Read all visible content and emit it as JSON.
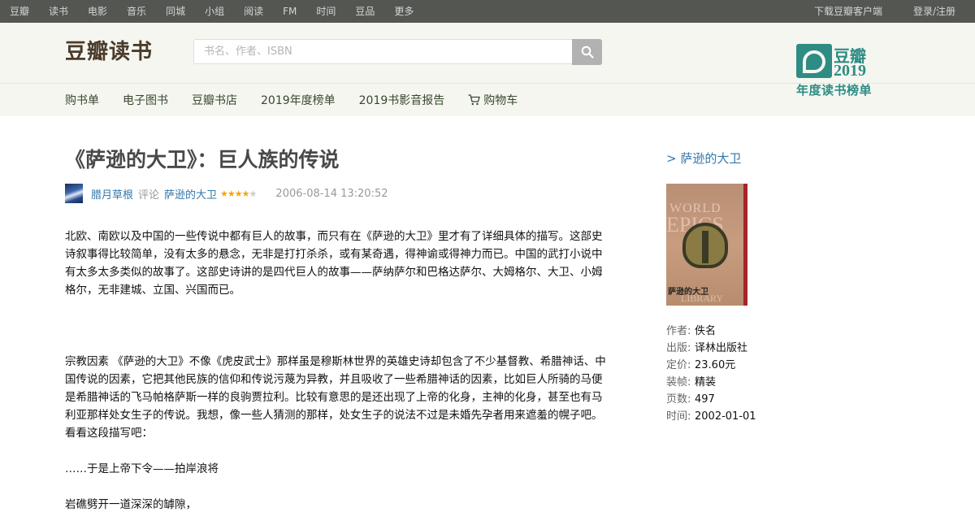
{
  "global_nav": {
    "left": [
      "豆瓣",
      "读书",
      "电影",
      "音乐",
      "同城",
      "小组",
      "阅读",
      "FM",
      "时间",
      "豆品",
      "更多"
    ],
    "right": [
      "下载豆瓣客户端",
      "登录/注册"
    ]
  },
  "header": {
    "logo": "豆瓣读书",
    "search_placeholder": "书名、作者、ISBN",
    "badge": {
      "name": "豆瓣",
      "year": "2019",
      "subtitle": "年度读书榜单"
    }
  },
  "subnav": [
    "购书单",
    "电子图书",
    "豆瓣书店",
    "2019年度榜单",
    "2019书影音报告",
    "购物车"
  ],
  "review": {
    "title": "《萨逊的大卫》：巨人族的传说",
    "author": "腊月草根",
    "verb": "评论",
    "book": "萨逊的大卫",
    "rating": 4,
    "date": "2006-08-14 13:20:52",
    "paragraphs": [
      "北欧、南欧以及中国的一些传说中都有巨人的故事，而只有在《萨逊的大卫》里才有了详细具体的描写。这部史诗叙事得比较简单，没有太多的悬念，无非是打打杀杀，或有某奇遇，得神谕或得神力而已。中国的武打小说中有太多太多类似的故事了。这部史诗讲的是四代巨人的故事——萨纳萨尔和巴格达萨尔、大姆格尔、大卫、小姆格尔，无非建城、立国、兴国而已。",
      "宗教因素 《萨逊的大卫》不像《虎皮武士》那样虽是穆斯林世界的英雄史诗却包含了不少基督教、希腊神话、中国传说的因素，它把其他民族的信仰和传说污蔑为异教，并且吸收了一些希腊神话的因素，比如巨人所骑的马便是希腊神话的飞马帕格萨斯一样的良驹贾拉利。比较有意思的是还出现了上帝的化身，主神的化身，甚至也有马利亚那样处女生子的传说。我想，像一些人猜测的那样，处女生子的说法不过是未婚先孕者用来遮羞的幌子吧。看看这段描写吧：",
      "……于是上帝下令——拍岸浪将",
      "岩礁劈开一道深深的罅隙，"
    ]
  },
  "aside": {
    "book_link": "> 萨逊的大卫",
    "cover": {
      "top": "WORLD",
      "middle": "EPICS",
      "cn": "萨逊的大卫",
      "bottom": "LIBRARY"
    },
    "info": [
      {
        "k": "作者:",
        "v": "佚名"
      },
      {
        "k": "出版:",
        "v": "译林出版社"
      },
      {
        "k": "定价:",
        "v": "23.60元"
      },
      {
        "k": "装帧:",
        "v": "精装"
      },
      {
        "k": "页数:",
        "v": "497"
      },
      {
        "k": "时间:",
        "v": "2002-01-01"
      }
    ]
  }
}
